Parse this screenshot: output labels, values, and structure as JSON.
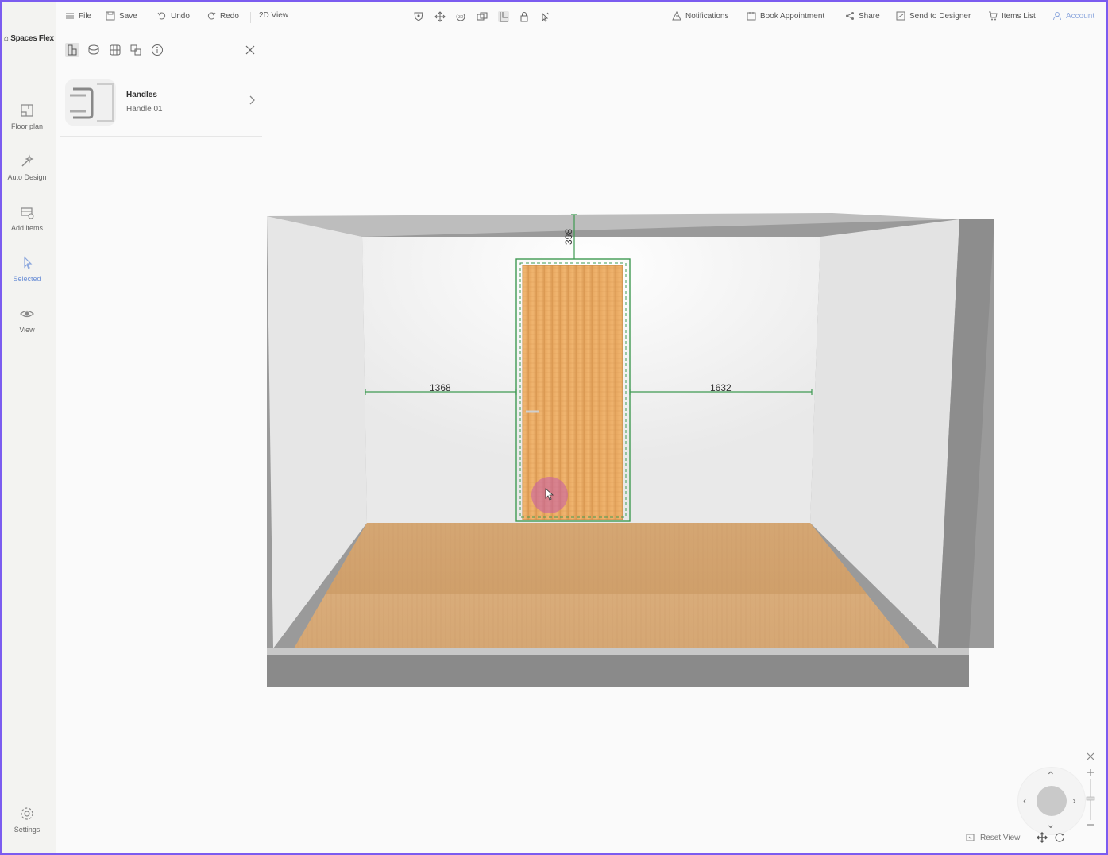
{
  "app": {
    "logo_text": "Spaces Flex"
  },
  "toolbar": {
    "file": "File",
    "save": "Save",
    "undo": "Undo",
    "redo": "Redo",
    "view2d": "2D View",
    "notifications": "Notifications",
    "book": "Book Appointment",
    "share": "Share",
    "send": "Send to Designer",
    "items": "Items List",
    "account": "Account"
  },
  "sidebar": {
    "items": [
      {
        "label": "Floor plan"
      },
      {
        "label": "Auto Design"
      },
      {
        "label": "Add items"
      },
      {
        "label": "Selected"
      },
      {
        "label": "View"
      }
    ],
    "settings": "Settings"
  },
  "panel": {
    "title": "Handles",
    "subtitle": "Handle 01"
  },
  "scene": {
    "dim_left": "1368",
    "dim_right": "1632",
    "dim_top": "398"
  },
  "controls": {
    "reset": "Reset View"
  },
  "colors": {
    "accent": "#6b8fd6",
    "frame": "#7b5cf0",
    "measure": "#3f9a52",
    "door": "#e4a35c",
    "floor": "#d7a876"
  }
}
